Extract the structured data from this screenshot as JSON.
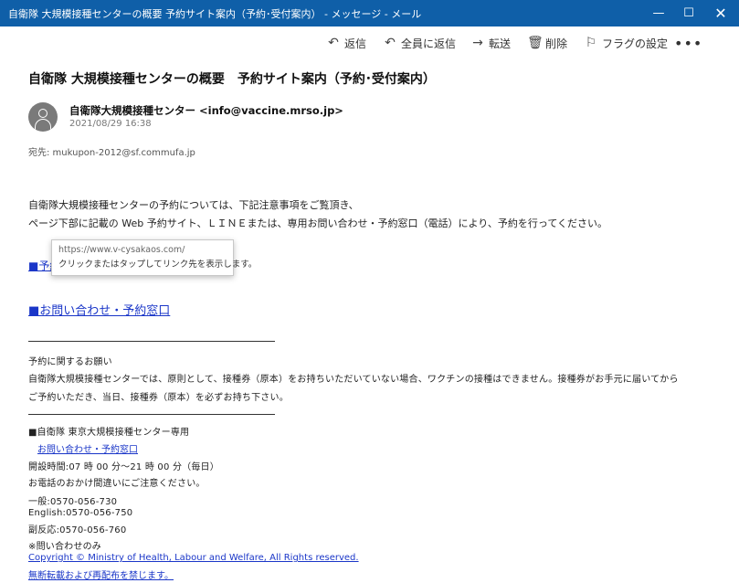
{
  "window": {
    "title": "自衛隊 大規模接種センターの概要 予約サイト案内（予約･受付案内） - メッセージ - メール",
    "minimize_glyph": "—",
    "maximize_glyph": "☐",
    "close_glyph": "✕"
  },
  "toolbar": {
    "reply": {
      "label": "返信",
      "icon": "reply-icon",
      "glyph": "↶"
    },
    "reply_all": {
      "label": "全員に返信",
      "icon": "reply-all-icon",
      "glyph": "↶"
    },
    "forward": {
      "label": "転送",
      "icon": "forward-icon",
      "glyph": "→"
    },
    "delete": {
      "label": "削除",
      "icon": "trash-icon",
      "glyph": "🗑"
    },
    "flag": {
      "label": "フラグの設定",
      "icon": "flag-icon",
      "glyph": "⚐"
    },
    "more": {
      "label": "•••",
      "icon": "more-icon"
    }
  },
  "message": {
    "subject": "自衛隊 大規模接種センターの概要　予約サイト案内（予約･受付案内）",
    "sender": "自衛隊大規模接種センター <info@vaccine.mrso.jp>",
    "date": "2021/08/29 16:38",
    "to_label": "宛先: mukupon-2012@sf.commufa.jp",
    "body_line1": "自衛隊大規模接種センターの予約については、下記注意事項をご覧頂き、",
    "body_line2": "ページ下部に記載の Web 予約サイト、ＬＩＮＥまたは、専用お問い合わせ・予約窓口（電話）により、予約を行ってください。",
    "link1_label": "■予約",
    "link2_label": "■お問い合わせ・予約窓口",
    "notice_title": "予約に関するお願い",
    "notice_line1": "自衛隊大規模接種センターでは、原則として、接種券（原本）をお持ちいただいていない場合、ワクチンの接種はできません。接種券がお手元に届いてから",
    "notice_line2": "ご予約いただき、当日、接種券（原本）を必ずお持ち下さい。",
    "center_title": "■自衛隊 東京大規模接種センター専用",
    "center_link": "お問い合わせ・予約窓口",
    "hours": "開設時間:07 時 00 分～21 時 00 分（毎日）",
    "caution": "お電話のおかけ間違いにご注意ください。",
    "general": "一般:0570-056-730",
    "english": "English:0570-056-750",
    "side_effects": "副反応:0570-056-760",
    "inquiries_only": "※問い合わせのみ",
    "copyright": "Copyright © Ministry of Health, Labour and Welfare, All Rights reserved.",
    "no_reprint": "無断転載および再配布を禁じます。"
  },
  "tooltip": {
    "url": "https://www.v-cysakaos.com/",
    "hint": "クリックまたはタップしてリンク先を表示します。"
  }
}
